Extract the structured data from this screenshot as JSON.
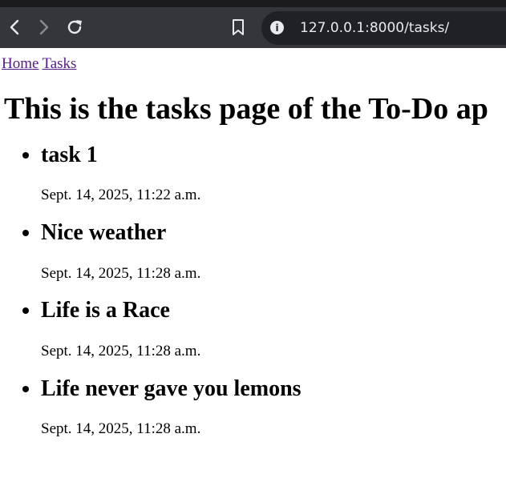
{
  "browser": {
    "url": "127.0.0.1:8000/tasks/"
  },
  "nav": {
    "home_label": "Home",
    "tasks_label": "Tasks"
  },
  "page": {
    "heading": "This is the tasks page of the To-Do ap"
  },
  "tasks": [
    {
      "title": "task 1",
      "date": "Sept. 14, 2025, 11:22 a.m."
    },
    {
      "title": "Nice weather",
      "date": "Sept. 14, 2025, 11:28 a.m."
    },
    {
      "title": "Life is a Race",
      "date": "Sept. 14, 2025, 11:28 a.m."
    },
    {
      "title": "Life never gave you lemons",
      "date": "Sept. 14, 2025, 11:28 a.m."
    }
  ]
}
